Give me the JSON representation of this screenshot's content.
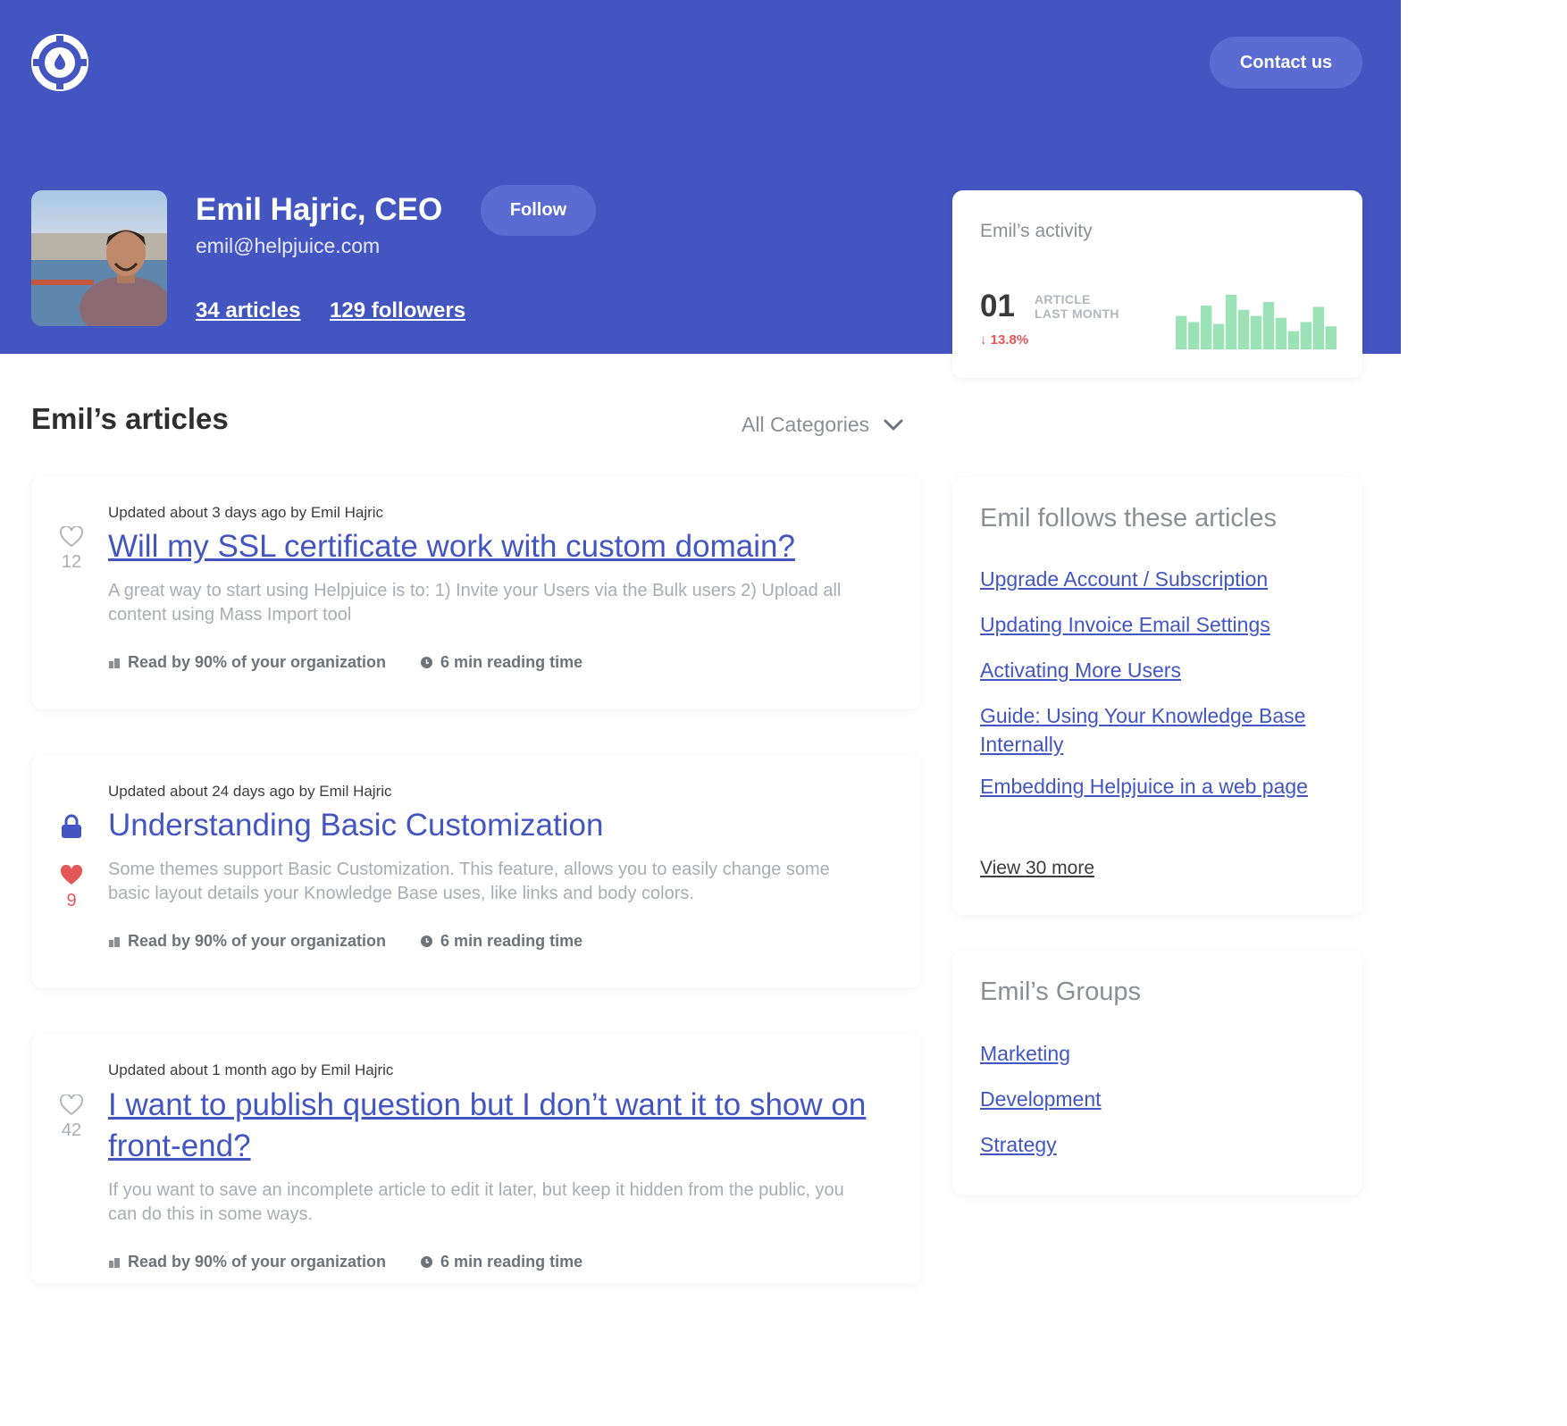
{
  "header": {
    "logo_icon": "lifebuoy-drop-icon",
    "contact_label": "Contact us"
  },
  "profile": {
    "name": "Emil Hajric, CEO",
    "email": "emil@helpjuice.com",
    "follow_label": "Follow",
    "articles_label": "34 articles",
    "followers_label": "129 followers"
  },
  "activity": {
    "title": "Emil’s activity",
    "count": "01",
    "label_line1": "ARTICLE",
    "label_line2": "LAST MONTH",
    "delta": "13.8%",
    "bars": [
      0.55,
      0.45,
      0.72,
      0.42,
      0.9,
      0.65,
      0.55,
      0.78,
      0.52,
      0.3,
      0.45,
      0.7,
      0.38
    ],
    "bar_color": "#9be3b6"
  },
  "articles_section": {
    "title": "Emil’s articles",
    "categories_label": "All Categories"
  },
  "articles": [
    {
      "meta": "Updated about 3 days ago by Emil Hajric",
      "title": "Will my SSL certificate work with custom domain?",
      "excerpt": "A great way to start using Helpjuice is to:   1) Invite your Users via the Bulk users  2) Upload all content using Mass Import tool",
      "read_by": "Read by 90% of your organization",
      "reading_time": "6 min reading time",
      "likes": "12"
    },
    {
      "meta": "Updated about 24 days ago by Emil Hajric",
      "title": "Understanding Basic Customization",
      "excerpt": "Some themes support Basic Customization. This feature, allows you to easily change some basic layout details your Knowledge Base uses, like links and body colors.",
      "read_by": "Read by 90% of your organization",
      "reading_time": "6 min reading time",
      "likes": "9"
    },
    {
      "meta": "Updated about 1 month ago by Emil Hajric",
      "title": "I want to publish question but I don’t want it to show on front-end?",
      "excerpt": "If you want to save an incomplete article to edit it later, but keep it hidden from the public, you can do this in some ways.",
      "read_by": "Read by 90% of your organization",
      "reading_time": "6 min reading time",
      "likes": "42"
    }
  ],
  "follows": {
    "title": "Emil follows these articles",
    "links": [
      "Upgrade Account / Subscription",
      "Updating Invoice Email Settings",
      "Activating More Users",
      "Guide: Using Your Knowledge Base Internally",
      "Embedding Helpjuice in a web page"
    ],
    "view_more": "View 30 more"
  },
  "groups": {
    "title": "Emil’s Groups",
    "links": [
      "Marketing",
      "Development",
      "Strategy"
    ]
  },
  "colors": {
    "brand": "#4355c1",
    "like_red": "#e35757"
  }
}
